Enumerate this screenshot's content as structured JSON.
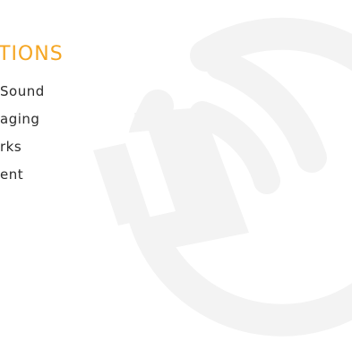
{
  "colors": {
    "accent": "#f5a623",
    "text": "#2b2b2b",
    "watermark": "#f3f3f3"
  },
  "section": {
    "heading": "TIONS"
  },
  "menu": {
    "items": [
      {
        "label": "Sound"
      },
      {
        "label": "aging"
      },
      {
        "label": "rks"
      },
      {
        "label": "ent"
      }
    ]
  },
  "watermark": {
    "icon": "speaker-sound-icon"
  }
}
